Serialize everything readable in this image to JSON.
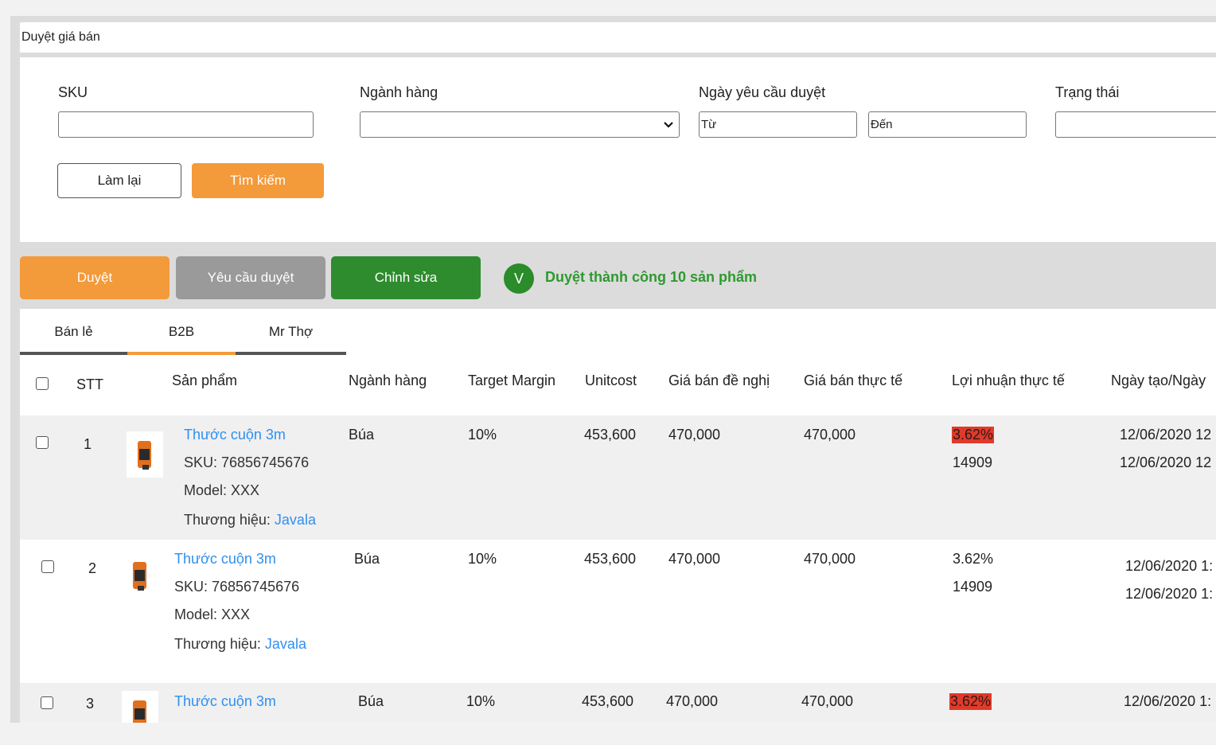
{
  "page": {
    "title": "Duyệt giá bán"
  },
  "filters": {
    "sku_label": "SKU",
    "category_label": "Ngành hàng",
    "date_label": "Ngày yêu cầu duyệt",
    "date_from": "Từ",
    "date_to": "Đến",
    "status_label": "Trạng thái",
    "reset": "Làm lại",
    "search": "Tìm kiếm"
  },
  "actions": {
    "approve": "Duyệt",
    "request": "Yêu cầu duyệt",
    "edit": "Chỉnh sửa",
    "success_icon": "V",
    "success_text": "Duyệt thành công 10 sản phẩm"
  },
  "colors": {
    "orange": "#f39a3a",
    "gray": "#9a9a9a",
    "green": "#2e8b2e",
    "link": "#2f8ff0",
    "negative": "#e03a2a"
  },
  "tabs": [
    "Bán lẻ",
    "B2B",
    "Mr Thợ"
  ],
  "columns": [
    "STT",
    "Sản phẩm",
    "Ngành hàng",
    "Target Margin",
    "Unitcost",
    "Giá bán đề nghị",
    "Giá bán thực tế",
    "Lợi nhuận thực tế",
    "Ngày tạo/Ngày"
  ],
  "rows": [
    {
      "stt": "1",
      "name": "Thước cuộn 3m",
      "sku": "SKU: 76856745676",
      "model": "Model: XXX",
      "brand_label": "Thương hiệu: ",
      "brand": "Javala",
      "category": "Búa",
      "target": "10%",
      "unitcost": "453,600",
      "suggest": "470,000",
      "actual": "470,000",
      "profit_pct": "3.62%",
      "profit_val": "14909",
      "date1": "12/06/2020 12",
      "date2": "12/06/2020 12"
    },
    {
      "stt": "2",
      "name": "Thước cuộn 3m",
      "sku": "SKU: 76856745676",
      "model": "Model: XXX",
      "brand_label": "Thương hiệu: ",
      "brand": "Javala",
      "category": "Búa",
      "target": "10%",
      "unitcost": "453,600",
      "suggest": "470,000",
      "actual": "470,000",
      "profit_pct": "3.62%",
      "profit_val": "14909",
      "date1": "12/06/2020 1:",
      "date2": "12/06/2020 1:"
    },
    {
      "stt": "3",
      "name": "Thước cuộn 3m",
      "category": "Búa",
      "target": "10%",
      "unitcost": "453,600",
      "suggest": "470,000",
      "actual": "470,000",
      "profit_pct": "3.62%",
      "date1": "12/06/2020 1:"
    }
  ]
}
